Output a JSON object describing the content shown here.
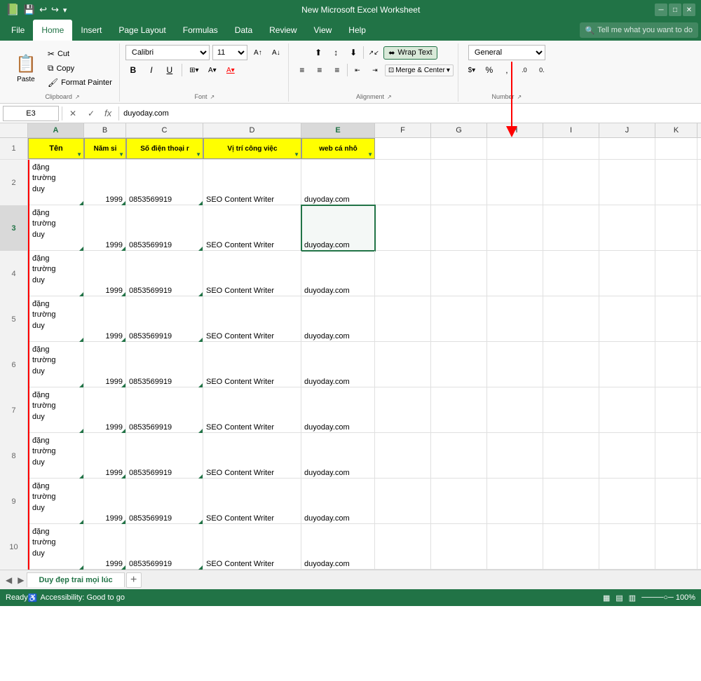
{
  "titleBar": {
    "title": "New Microsoft Excel Worksheet",
    "quickAccess": [
      "💾",
      "↩",
      "↪",
      "▾"
    ]
  },
  "menuBar": {
    "items": [
      "File",
      "Home",
      "Insert",
      "Page Layout",
      "Formulas",
      "Data",
      "Review",
      "View",
      "Help"
    ],
    "activeItem": "Home",
    "searchPlaceholder": "Tell me what you want to do"
  },
  "ribbon": {
    "clipboard": {
      "label": "Clipboard",
      "paste": "Paste",
      "cut": "Cut",
      "copy": "Copy",
      "formatPainter": "Format Painter"
    },
    "font": {
      "label": "Font",
      "fontName": "Calibri",
      "fontSize": "11",
      "bold": "B",
      "italic": "I",
      "underline": "U"
    },
    "alignment": {
      "label": "Alignment",
      "wrapText": "Wrap Text",
      "mergeCenter": "Merge & Center"
    },
    "number": {
      "label": "Number",
      "format": "General"
    }
  },
  "formulaBar": {
    "cellRef": "E3",
    "formula": "duyoday.com"
  },
  "columns": {
    "widths": [
      40,
      80,
      100,
      110,
      90,
      140,
      100,
      80,
      80,
      80,
      80
    ],
    "headers": [
      "",
      "A",
      "B",
      "C",
      "D",
      "E",
      "F",
      "G",
      "H",
      "I",
      "J",
      "K"
    ],
    "labels": [
      "Tên",
      "Năm si▼",
      "Số điện thoại r▼",
      "Vị trí công việc",
      "web cá nhô▼"
    ]
  },
  "rows": [
    {
      "num": 1,
      "cells": [
        "Tên",
        "Năm si▼",
        "Số điện thoại r▼",
        "Vị trí công việc",
        "web cá nhô▼",
        "",
        "",
        "",
        "",
        "",
        ""
      ],
      "isHeader": true
    },
    {
      "num": 2,
      "cells": [
        "đặng\ntrường\nduy",
        "1999",
        "0853569919",
        "SEO Content Writer",
        "duyoday.com",
        "",
        "",
        "",
        "",
        "",
        ""
      ],
      "isHeader": false
    },
    {
      "num": 3,
      "cells": [
        "đặng\ntrường\nduy",
        "1999",
        "0853569919",
        "SEO Content Writer",
        "duyoday.com",
        "",
        "",
        "",
        "",
        "",
        ""
      ],
      "isHeader": false,
      "selected": "E3"
    },
    {
      "num": 4,
      "cells": [
        "đặng\ntrường\nduy",
        "1999",
        "0853569919",
        "SEO Content Writer",
        "duyoday.com",
        "",
        "",
        "",
        "",
        "",
        ""
      ],
      "isHeader": false
    },
    {
      "num": 5,
      "cells": [
        "đặng\ntrường\nduy",
        "1999",
        "0853569919",
        "SEO Content Writer",
        "duyoday.com",
        "",
        "",
        "",
        "",
        "",
        ""
      ],
      "isHeader": false
    },
    {
      "num": 6,
      "cells": [
        "đặng\ntrường\nduy",
        "1999",
        "0853569919",
        "SEO Content Writer",
        "duyoday.com",
        "",
        "",
        "",
        "",
        "",
        ""
      ],
      "isHeader": false
    },
    {
      "num": 7,
      "cells": [
        "đặng\ntrường\nduy",
        "1999",
        "0853569919",
        "SEO Content Writer",
        "duyoday.com",
        "",
        "",
        "",
        "",
        "",
        ""
      ],
      "isHeader": false
    },
    {
      "num": 8,
      "cells": [
        "đặng\ntrường\nduy",
        "1999",
        "0853569919",
        "SEO Content Writer",
        "duyoday.com",
        "",
        "",
        "",
        "",
        "",
        ""
      ],
      "isHeader": false
    },
    {
      "num": 9,
      "cells": [
        "đặng\ntrường\nduy",
        "1999",
        "0853569919",
        "SEO Content Writer",
        "duyoday.com",
        "",
        "",
        "",
        "",
        "",
        ""
      ],
      "isHeader": false
    },
    {
      "num": 10,
      "cells": [
        "đặng\ntrường\nduy",
        "1999",
        "0853569919",
        "SEO Content Writer",
        "duyoday.com",
        "",
        "",
        "",
        "",
        "",
        ""
      ],
      "isHeader": false
    }
  ],
  "sheetTabs": {
    "active": "Duy đẹp trai mọi lúc",
    "tabs": [
      "Duy đẹp trai mọi lúc"
    ]
  },
  "statusBar": {
    "ready": "Ready",
    "accessibility": "Accessibility: Good to go"
  }
}
